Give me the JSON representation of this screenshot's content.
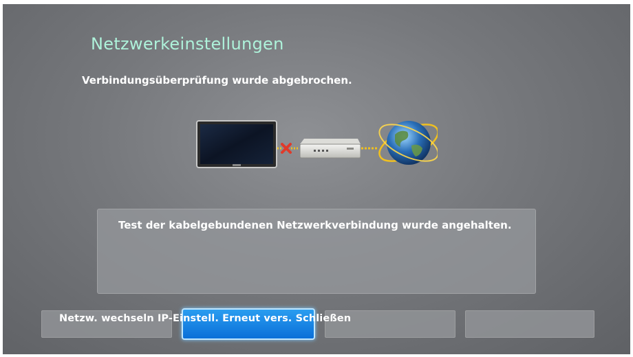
{
  "dialog": {
    "title": "Netzwerkeinstellungen",
    "status": "Verbindungsüberprüfung wurde abgebrochen.",
    "message": "Test der kabelgebundenen Netzwerkverbindung wurde angehalten."
  },
  "diagram": {
    "icons": [
      "tv-icon",
      "disconnected-x-icon",
      "router-icon",
      "globe-icon"
    ],
    "colors": {
      "link": "#f0c020",
      "error": "#e03a2a"
    }
  },
  "buttons": [
    {
      "label": "Netzw. wechseln",
      "focused": false
    },
    {
      "label": "IP-Einstell.",
      "focused": true
    },
    {
      "label": "Erneut vers.",
      "focused": false
    },
    {
      "label": "Schließen",
      "focused": false
    }
  ],
  "colors": {
    "title": "#aef2da",
    "focus": "#0a6fd8"
  }
}
